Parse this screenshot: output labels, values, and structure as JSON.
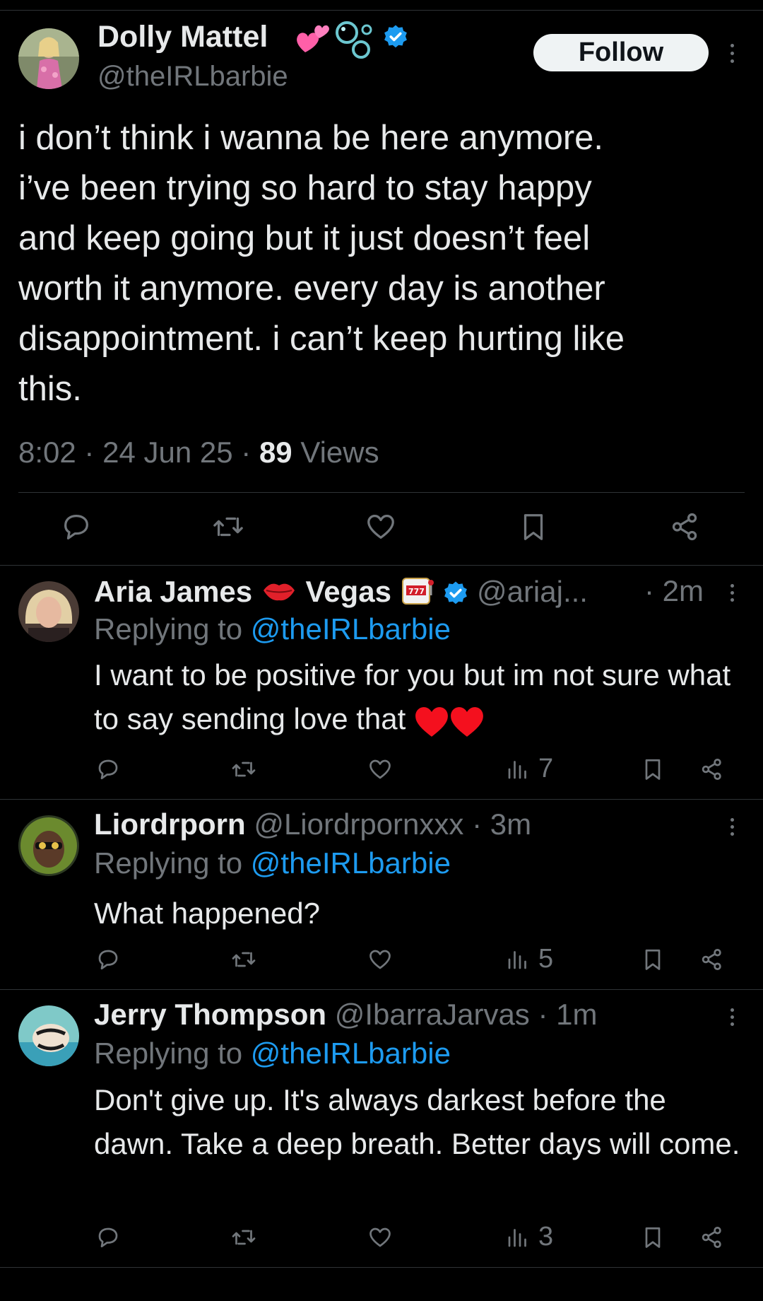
{
  "main_tweet": {
    "author_name": "Dolly Mattel",
    "handle": "@theIRLbarbie",
    "follow_label": "Follow",
    "text": "i don’t think i wanna be here anymore.\ni’ve been trying so hard to stay happy\nand keep going but it just doesn’t feel\nworth it anymore. every day is another\ndisappointment. i can’t keep hurting like\nthis.",
    "time": "8:02",
    "date": "24 Jun 25",
    "views_count": "89",
    "views_label": "Views",
    "separator": "·",
    "icons": [
      "reply-icon",
      "retweet-icon",
      "like-icon",
      "bookmark-icon",
      "share-icon"
    ]
  },
  "replies": [
    {
      "name_part1": "Aria James",
      "name_part2": "Vegas",
      "handle": "@ariaj...",
      "time": "· 2m",
      "replying_prefix": "Replying to",
      "replying_handle": "@theIRLbarbie",
      "text": "I want to be positive for you but im not sure what to say sending love that",
      "views": "7",
      "verified": true
    },
    {
      "name": "Liordrporn",
      "handle": "@Liordrpornxxx",
      "time": "· 3m",
      "replying_prefix": "Replying to",
      "replying_handle": "@theIRLbarbie",
      "text": "What happened?",
      "views": "5"
    },
    {
      "name": "Jerry Thompson",
      "handle": "@IbarraJarvas",
      "time": "· 1m",
      "replying_prefix": "Replying to",
      "replying_handle": "@theIRLbarbie",
      "text": "Don't give up. It's always darkest before the dawn. Take a deep breath. Better days will come.",
      "views": "3"
    }
  ],
  "colors": {
    "background": "#000000",
    "text": "#e7e9ea",
    "secondary": "#71767b",
    "link": "#1d9bf0",
    "divider": "#2f3336",
    "verified": "#1d9bf0",
    "follow_bg": "#eff3f4"
  }
}
